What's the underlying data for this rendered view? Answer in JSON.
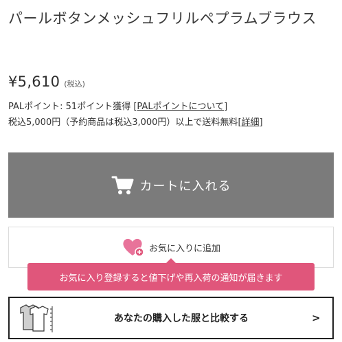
{
  "product": {
    "title": "パールボタンメッシュフリルペプラムブラウス",
    "price": "¥5,610",
    "tax_label": "(税込)"
  },
  "points": {
    "prefix": "PALポイント: 51ポイント獲得 ",
    "link_label": "[PALポイントについて]"
  },
  "shipping": {
    "text": "税込5,000円（予約商品は税込3,000円）以上で送料無料",
    "link_label": "[詳細]"
  },
  "cart_button": {
    "label": "カートに入れる",
    "icon": "cart-icon"
  },
  "favorite_button": {
    "label": "お気に入りに追加",
    "icon": "heart-plus-icon"
  },
  "tooltip": {
    "text": "お気に入り登録すると値下げや再入荷の通知が届きます"
  },
  "compare_button": {
    "label": "あなたの購入した服と比較する",
    "chevron": ">",
    "icon": "shirt-compare-icon"
  },
  "colors": {
    "cart_bg": "#7b7b7b",
    "tooltip_bg": "#e0567b",
    "heart": "#e8739a"
  }
}
